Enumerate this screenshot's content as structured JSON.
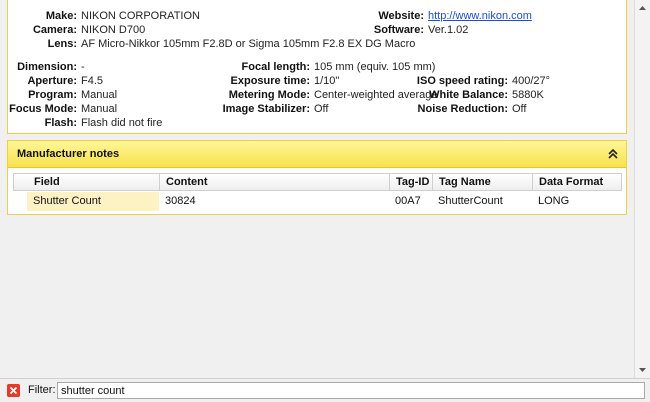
{
  "exif": {
    "make": {
      "label": "Make:",
      "value": "NIKON CORPORATION"
    },
    "camera": {
      "label": "Camera:",
      "value": "NIKON D700"
    },
    "lens": {
      "label": "Lens:",
      "value": "AF Micro-Nikkor 105mm F2.8D or Sigma 105mm F2.8 EX DG Macro"
    },
    "website": {
      "label": "Website:",
      "value": "http://www.nikon.com"
    },
    "software": {
      "label": "Software:",
      "value": "Ver.1.02"
    },
    "dimension": {
      "label": "Dimension:",
      "value": "-"
    },
    "aperture": {
      "label": "Aperture:",
      "value": "F4.5"
    },
    "program": {
      "label": "Program:",
      "value": "Manual"
    },
    "focus_mode": {
      "label": "Focus Mode:",
      "value": "Manual"
    },
    "flash": {
      "label": "Flash:",
      "value": "Flash did not fire"
    },
    "focal_length": {
      "label": "Focal length:",
      "value": "105 mm (equiv. 105 mm)"
    },
    "exposure_time": {
      "label": "Exposure time:",
      "value": "1/10\""
    },
    "metering_mode": {
      "label": "Metering Mode:",
      "value": "Center-weighted average"
    },
    "image_stabilizer": {
      "label": "Image Stabilizer:",
      "value": "Off"
    },
    "iso": {
      "label": "ISO speed rating:",
      "value": "400/27°"
    },
    "white_balance": {
      "label": "White Balance:",
      "value": "5880K"
    },
    "noise_reduction": {
      "label": "Noise Reduction:",
      "value": "Off"
    }
  },
  "manufacturer_notes": {
    "title": "Manufacturer notes",
    "columns": [
      "Field",
      "Content",
      "Tag-ID",
      "Tag Name",
      "Data Format"
    ],
    "rows": [
      {
        "field": "Shutter Count",
        "content": "30824",
        "tag_id": "00A7",
        "tag_name": "ShutterCount",
        "data_format": "LONG"
      }
    ]
  },
  "filter": {
    "label": "Filter:",
    "value": "shutter count"
  },
  "icons": {
    "collapse": "double-chevron-up-icon",
    "clear_filter": "clear-filter-icon"
  },
  "colors": {
    "accent": "#f8e24a",
    "border": "#f2cf3c",
    "link": "#1a4ed8",
    "selected_cell": "#fdf2c4",
    "clear_icon": "#e53a2c"
  }
}
